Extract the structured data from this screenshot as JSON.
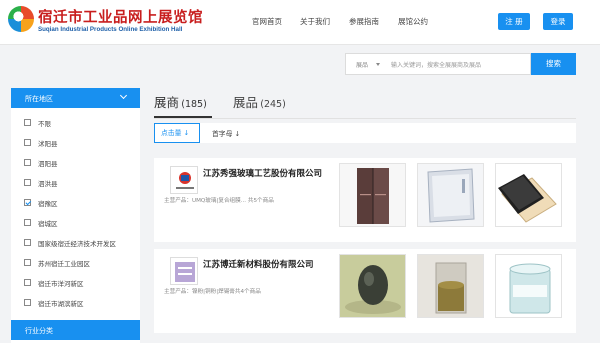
{
  "header": {
    "logo_cn": "宿迁市工业品网上展览馆",
    "logo_en": "Suqian Industrial Products Online Exhibition Hall",
    "nav": [
      "官网首页",
      "关于我们",
      "参展指南",
      "展馆公约"
    ],
    "register_label": "注 册",
    "login_label": "登录"
  },
  "search": {
    "category": "展品",
    "placeholder": "输入关键词，搜索全展展商及展品",
    "button_label": "搜索"
  },
  "sidebar": {
    "region_title": "所在地区",
    "regions": [
      {
        "label": "不限",
        "checked": false
      },
      {
        "label": "沭阳县",
        "checked": false
      },
      {
        "label": "泗阳县",
        "checked": false
      },
      {
        "label": "泗洪县",
        "checked": false
      },
      {
        "label": "宿豫区",
        "checked": true
      },
      {
        "label": "宿城区",
        "checked": false
      },
      {
        "label": "国家级宿迁经济技术开发区",
        "checked": false
      },
      {
        "label": "苏州宿迁工业园区",
        "checked": false
      },
      {
        "label": "宿迁市洋河新区",
        "checked": false
      },
      {
        "label": "宿迁市湖滨新区",
        "checked": false
      }
    ],
    "industry_title": "行业分类"
  },
  "tabs": [
    {
      "name": "展商",
      "count": "(185)",
      "active": true
    },
    {
      "name": "展品",
      "count": "(245)",
      "active": false
    }
  ],
  "sort": {
    "by_clicks": "点击量 ↓",
    "by_initial": "首字母 ↓"
  },
  "exhibitors": [
    {
      "name": "江苏秀强玻璃工艺股份有限公司",
      "main_products": "主营产品：UMQ玻璃|复合组膜...   共5个商品",
      "products": [
        "fridge",
        "panel",
        "phone"
      ]
    },
    {
      "name": "江苏博迁新材料股份有限公司",
      "main_products": "主营产品：镍粉|铜粉|焊锡膏共4个商品",
      "products": [
        "powder",
        "jar",
        "paste"
      ]
    }
  ],
  "colors": {
    "accent": "#1890f0",
    "logo_red": "#c81e1e",
    "logo_blue": "#1e5fa8"
  }
}
